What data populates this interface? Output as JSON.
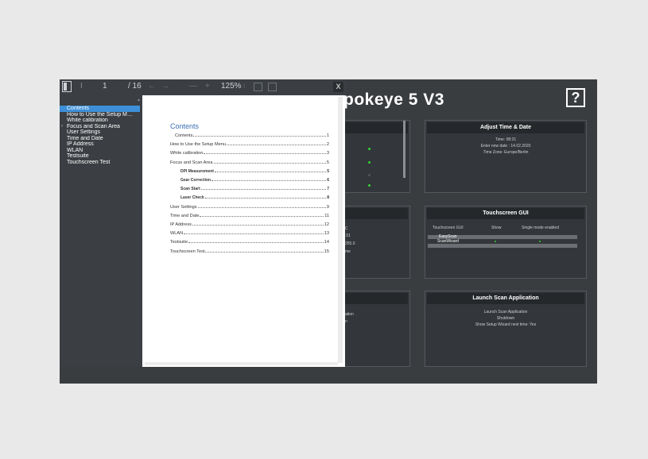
{
  "app": {
    "title": "pokeye 5 V3",
    "help_label": "?"
  },
  "panels": {
    "adjust_time": {
      "title": "Adjust Time & Date",
      "lines": [
        "Time: 08:31",
        "Enter new date : 14.02.2020",
        "Time Zone: Europe/Berlin"
      ]
    },
    "touchscreen_gui": {
      "title": "Touchscreen GUI",
      "headers": [
        "Touchscreen GUI",
        "Show",
        "Single mode enabled"
      ],
      "rows": [
        "EasyScan",
        "ScanWizard"
      ]
    },
    "launch_scan": {
      "title": "Launch Scan Application",
      "lines": [
        "Launch Scan Application",
        "Shutdown",
        "Show Setup Wizard next time: Yes"
      ]
    },
    "partial_middle": {
      "lines": [
        "C",
        ".51",
        "255.0",
        "me"
      ]
    },
    "partial_bottom": {
      "lines": [
        "ation",
        "n"
      ]
    }
  },
  "viewer": {
    "page_current": "1",
    "page_total": "/ 16",
    "zoom": "125%",
    "close_label": "X",
    "outline": [
      {
        "label": "Contents",
        "selected": true
      },
      {
        "label": "How to Use the Setup M…",
        "selected": false
      },
      {
        "label": "White calibration",
        "selected": false
      },
      {
        "label": "Focus and Scan Area",
        "selected": false,
        "expandable": true
      },
      {
        "label": "User Settings",
        "selected": false
      },
      {
        "label": "Time and Date",
        "selected": false
      },
      {
        "label": "IP Address",
        "selected": false
      },
      {
        "label": "WLAN",
        "selected": false
      },
      {
        "label": "Testsuite",
        "selected": false
      },
      {
        "label": "Touchscreen Test",
        "selected": false
      }
    ],
    "toc": {
      "title": "Contents",
      "entries": [
        {
          "label": "Contents",
          "page": "1",
          "sub": false,
          "indent": true
        },
        {
          "label": "How to Use the Setup Menu",
          "page": "2",
          "sub": false
        },
        {
          "label": "White calibration",
          "page": "3",
          "sub": false
        },
        {
          "label": "Focus and Scan Area",
          "page": "5",
          "sub": false
        },
        {
          "label": "DPI Measurement",
          "page": "5",
          "sub": true
        },
        {
          "label": "Gear Correction",
          "page": "6",
          "sub": true
        },
        {
          "label": "Scan Start",
          "page": "7",
          "sub": true
        },
        {
          "label": "Laser Check",
          "page": "8",
          "sub": true
        },
        {
          "label": "User Settings",
          "page": "9",
          "sub": false
        },
        {
          "label": "Time and Date",
          "page": "11",
          "sub": false
        },
        {
          "label": "IP Address",
          "page": "12",
          "sub": false
        },
        {
          "label": "WLAN",
          "page": "13",
          "sub": false
        },
        {
          "label": "Testsuite",
          "page": "14",
          "sub": false
        },
        {
          "label": "Touchscreen Test",
          "page": "15",
          "sub": false
        }
      ]
    }
  },
  "colors": {
    "app_bg": "#3a3d40",
    "panel_bg": "#33363a",
    "accent_selected": "#3d8fd8",
    "status_green": "#33d233",
    "toc_title": "#3a6fb0"
  }
}
